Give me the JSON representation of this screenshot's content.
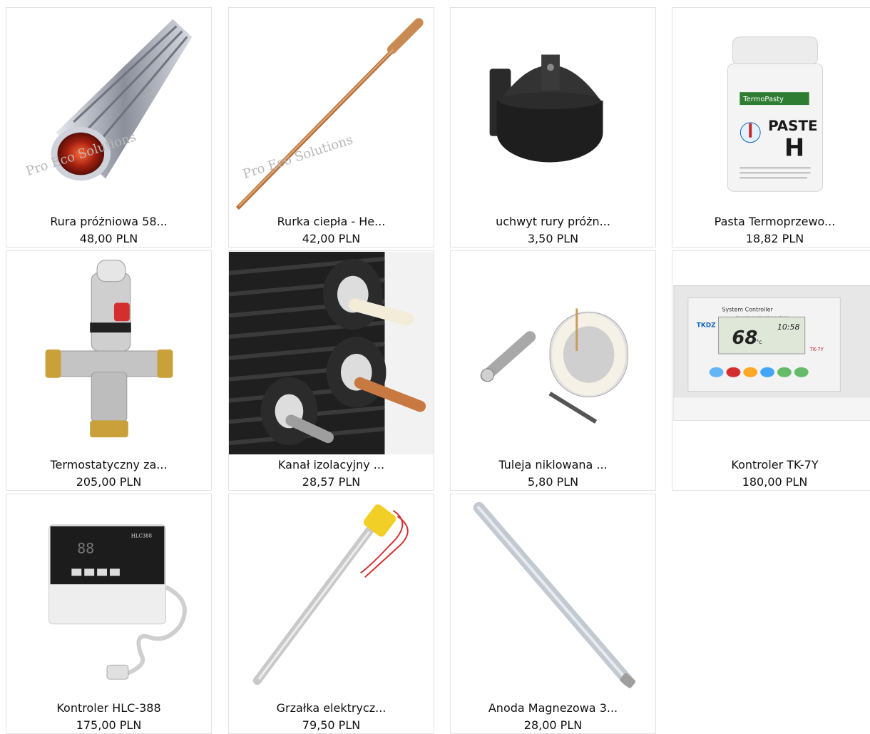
{
  "products": [
    {
      "name": "Rura próżniowa 58...",
      "price": "48,00 PLN",
      "image_icon": "vacuum-tube-icon",
      "watermark": "Pro Eco Solutions"
    },
    {
      "name": "Rurka ciepła - He...",
      "price": "42,00 PLN",
      "image_icon": "heat-pipe-icon",
      "watermark": "Pro Eco Solutions"
    },
    {
      "name": "uchwyt rury próżn...",
      "price": "3,50 PLN",
      "image_icon": "tube-holder-icon"
    },
    {
      "name": "Pasta Termoprzewo...",
      "price": "18,82 PLN",
      "image_icon": "paste-jar-icon",
      "jar_brand": "TermoPasty",
      "jar_label_1": "PASTE",
      "jar_label_2": "H"
    },
    {
      "name": "Termostatyczny za...",
      "price": "205,00 PLN",
      "image_icon": "thermostatic-valve-icon"
    },
    {
      "name": "Kanał izolacyjny ...",
      "price": "28,57 PLN",
      "image_icon": "insulated-pipe-icon"
    },
    {
      "name": "Tuleja niklowana ...",
      "price": "5,80 PLN",
      "image_icon": "nickel-sleeve-icon"
    },
    {
      "name": "Kontroler TK-7Y",
      "price": "180,00 PLN",
      "image_icon": "controller-tk7y-icon",
      "panel_title": "System Controller",
      "panel_sub": "for solar and heating systems",
      "brand": "TKDZ",
      "temp": "68",
      "unit": "°c",
      "time": "10:58",
      "model": "TK-7Y"
    },
    {
      "name": "Kontroler HLC-388",
      "price": "175,00 PLN",
      "image_icon": "controller-hlc388-icon",
      "screen_digits": "88",
      "model": "HLC388"
    },
    {
      "name": "Grzałka elektrycz...",
      "price": "79,50 PLN",
      "image_icon": "electric-heater-icon"
    },
    {
      "name": "Anoda Magnezowa 3...",
      "price": "28,00 PLN",
      "image_icon": "magnesium-anode-icon"
    }
  ]
}
